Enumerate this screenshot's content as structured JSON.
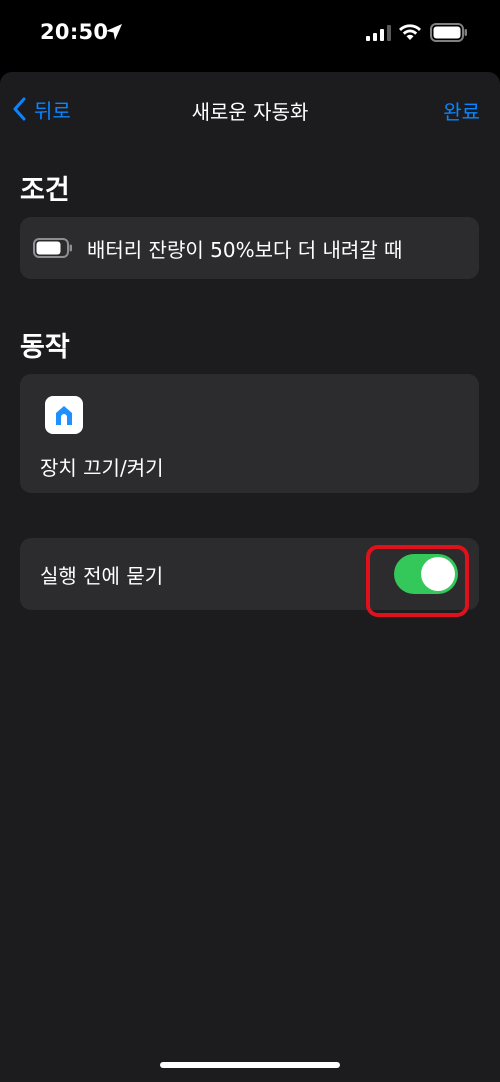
{
  "status_bar": {
    "time": "20:50"
  },
  "nav": {
    "back_label": "뒤로",
    "title": "새로운 자동화",
    "done_label": "완료"
  },
  "condition": {
    "header": "조건",
    "text": "배터리 잔량이 50%보다 더 내려갈 때"
  },
  "action": {
    "header": "동작",
    "label": "장치 끄기/켜기"
  },
  "ask_before_running": {
    "label": "실행 전에 묻기",
    "enabled": true
  },
  "colors": {
    "accent": "#0a84ff",
    "toggle_on": "#34c759",
    "highlight": "#e0111b",
    "card": "#2c2c2e",
    "background": "#1c1c1e"
  }
}
